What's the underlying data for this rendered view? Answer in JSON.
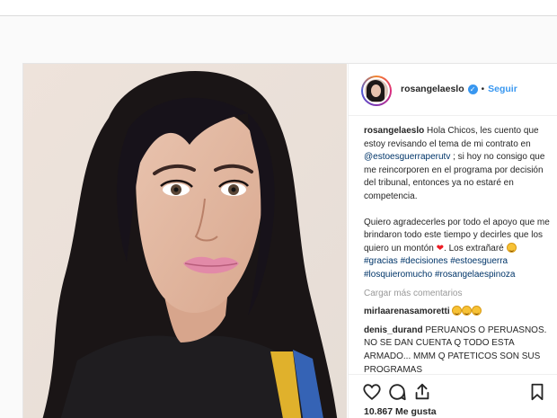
{
  "post": {
    "username": "rosangelaeslo",
    "follow_label": "Seguir",
    "separator": "•",
    "caption": {
      "author": "rosangelaeslo",
      "text_1": " Hola Chicos, les cuento que estoy revisando el tema de mi contrato en ",
      "mention": "@estoesguerraperutv",
      "text_2": " ; si hoy no consigo que me reincorporen en el programa por decisión del tribunal, entonces ya no estaré en competencia.",
      "text_3": "Quiero agradecerles por todo el apoyo que me brindaron todo este tiempo y decirles que los quiero un montón ",
      "heart": "❤",
      "text_4": ". Los extrañaré ",
      "hashtags": [
        "#gracias",
        "#decisiones",
        "#estoesguerra",
        "#losquieromucho",
        "#rosangelaespinoza"
      ]
    },
    "load_more_label": "Cargar más comentarios",
    "comments": [
      {
        "user": "mirlaarenasamoretti",
        "text": ""
      },
      {
        "user": "denis_durand",
        "text": "PERUANOS O PERUASNOS. NO SE DAN CUENTA Q TODO ESTA ARMADO... MMM Q PATETICOS SON SUS PROGRAMAS"
      }
    ],
    "likes_label": "10.867 Me gusta",
    "icons": {
      "verified": "verified-badge-icon",
      "like": "heart-outline-icon",
      "comment": "comment-bubble-icon",
      "share": "share-icon",
      "save": "bookmark-icon"
    },
    "colors": {
      "link": "#3897f0",
      "hashtag": "#003569",
      "muted": "#999999",
      "text": "#262626"
    }
  }
}
